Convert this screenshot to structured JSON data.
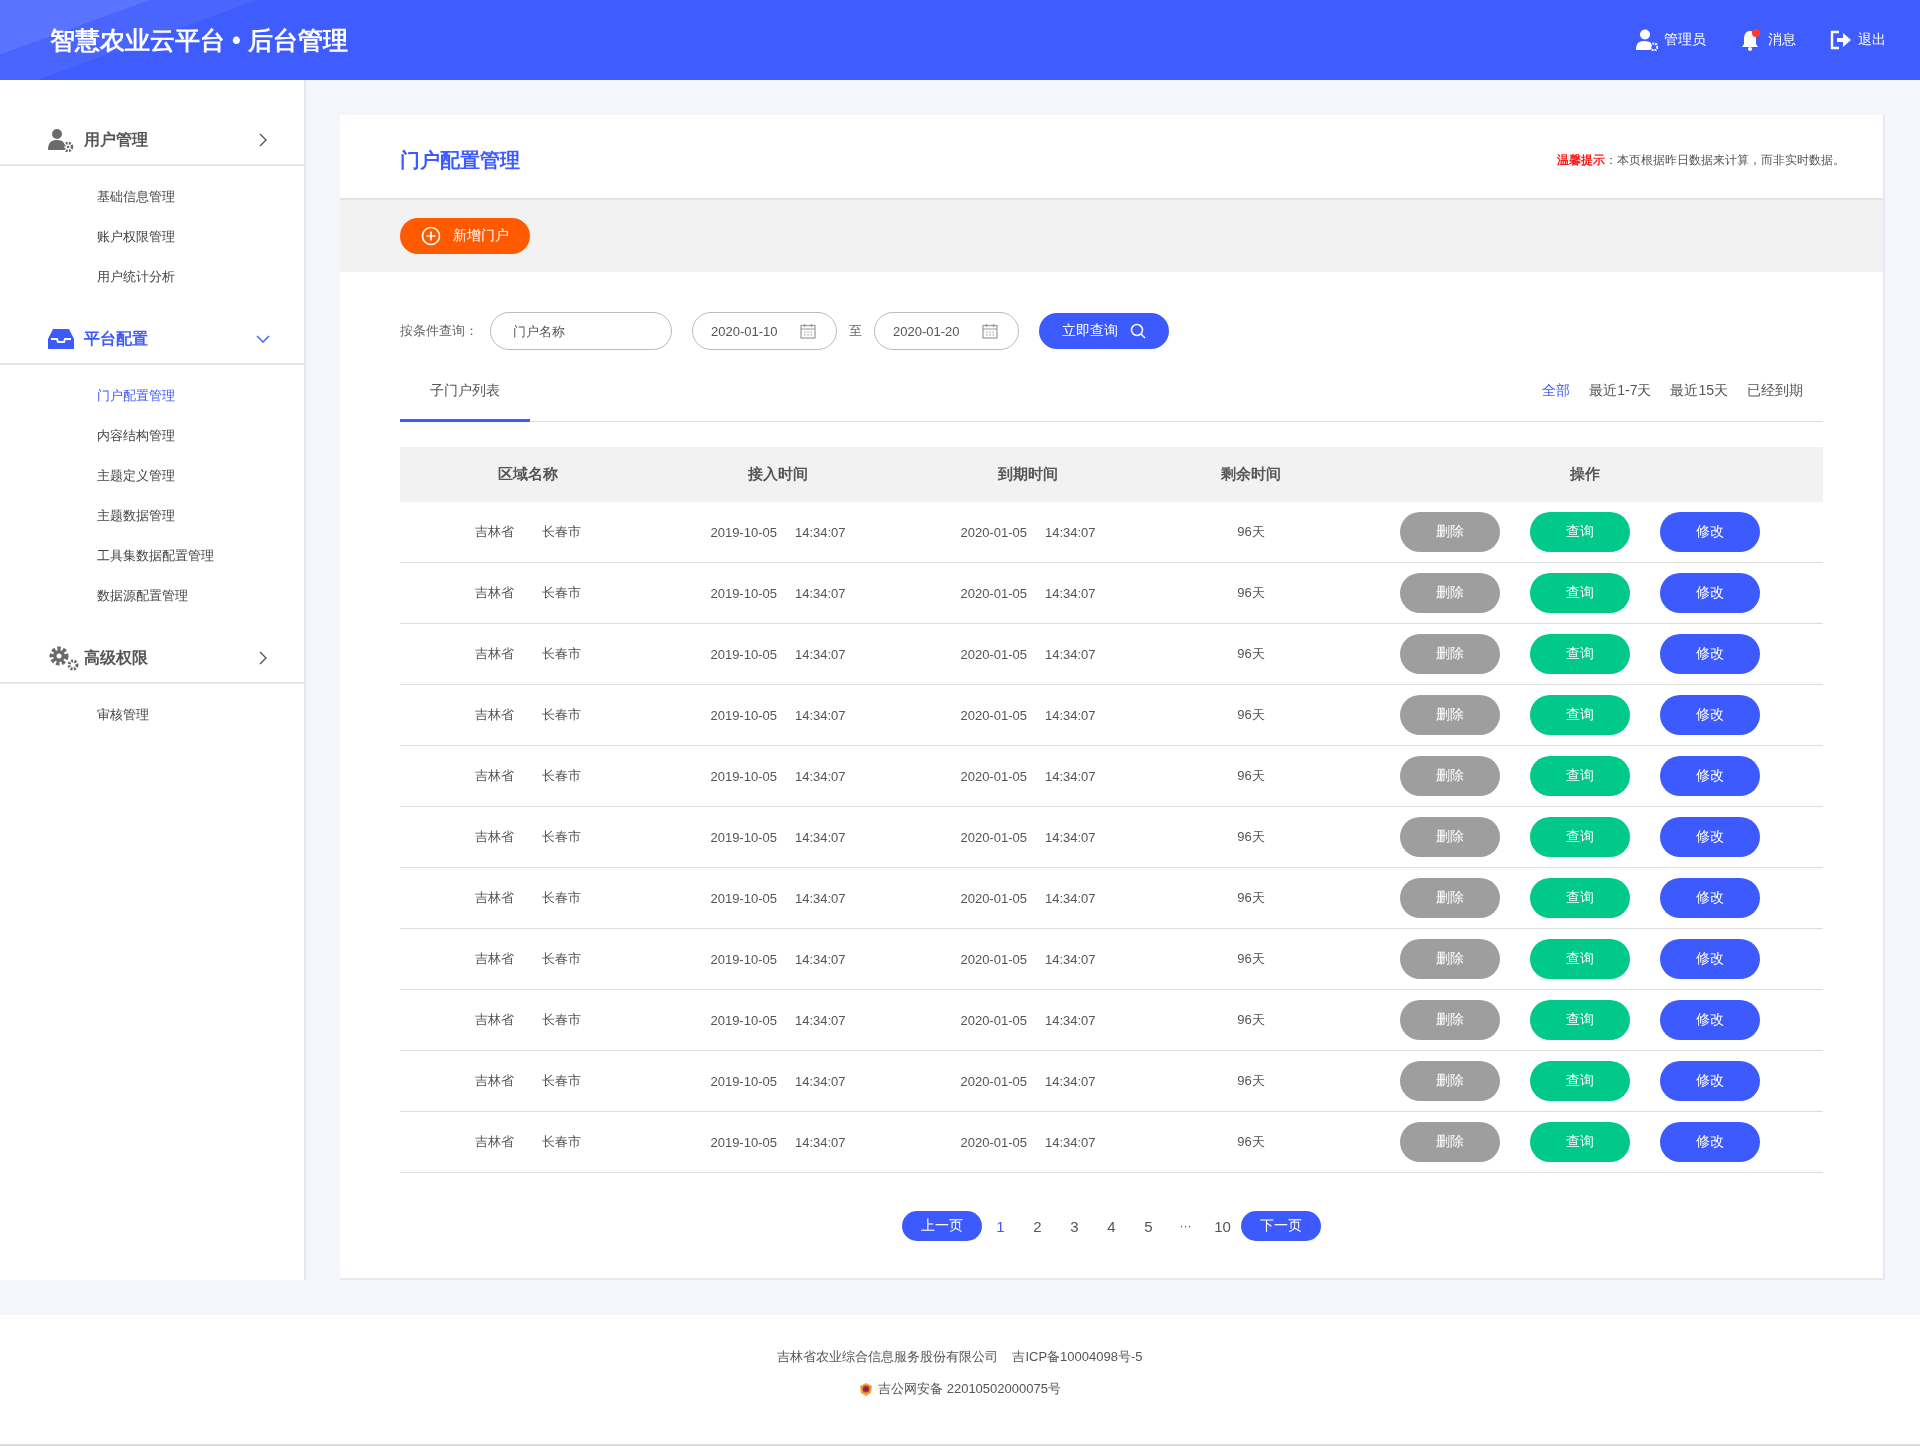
{
  "header": {
    "title": "智慧农业云平台 • 后台管理",
    "actions": [
      {
        "kind": "user",
        "label": "管理员"
      },
      {
        "kind": "bell",
        "label": "消息",
        "badge": true
      },
      {
        "kind": "logout",
        "label": "退出"
      }
    ]
  },
  "sidebar": {
    "groups": [
      {
        "kind": "user",
        "label": "用户管理",
        "selected": false,
        "expanded": false,
        "items": [
          {
            "label": "基础信息管理",
            "selected": false
          },
          {
            "label": "账户权限管理",
            "selected": false
          },
          {
            "label": "用户统计分析",
            "selected": false
          }
        ]
      },
      {
        "kind": "inbox",
        "label": "平台配置",
        "selected": true,
        "expanded": true,
        "items": [
          {
            "label": "门户配置管理",
            "selected": true
          },
          {
            "label": "内容结构管理",
            "selected": false
          },
          {
            "label": "主题定义管理",
            "selected": false
          },
          {
            "label": "主题数据管理",
            "selected": false
          },
          {
            "label": "工具集数据配置管理",
            "selected": false
          },
          {
            "label": "数据源配置管理",
            "selected": false
          }
        ]
      },
      {
        "kind": "gear",
        "label": "高级权限",
        "selected": false,
        "expanded": false,
        "items": [
          {
            "label": "审核管理",
            "selected": false
          }
        ]
      }
    ]
  },
  "page": {
    "title": "门户配置管理",
    "notice": "**温馨提示**：本页根据昨日数据来计算，而非实时数据。",
    "add_button": "新增门户"
  },
  "filter": {
    "label": "按条件查询：",
    "name_field": {
      "placeholder": "门户名称"
    },
    "date_from": "2020-01-10",
    "separator": "至",
    "date_to": "2020-01-20",
    "search_button": "立即查询"
  },
  "tabs": [
    {
      "label": "子门户列表",
      "selected": true
    }
  ],
  "ranges": [
    {
      "label": "全部",
      "selected": true
    },
    {
      "label": "最近1-7天",
      "selected": false
    },
    {
      "label": "最近15天",
      "selected": false
    },
    {
      "label": "已经到期",
      "selected": false
    }
  ],
  "table": {
    "columns": [
      "区域名称",
      "接入时间",
      "到期时间",
      "剩余时间",
      "操作"
    ],
    "rows": [
      {
        "province": "吉林省",
        "city": "长春市",
        "join_date": "2019-10-05",
        "join_time": "14:34:07",
        "expire_date": "2020-01-05",
        "expire_time": "14:34:07",
        "remaining": "96天",
        "actions": [
          {
            "kind": "delete",
            "label": "删除"
          },
          {
            "kind": "view",
            "label": "查询"
          },
          {
            "kind": "edit",
            "label": "修改"
          }
        ]
      },
      {
        "province": "吉林省",
        "city": "长春市",
        "join_date": "2019-10-05",
        "join_time": "14:34:07",
        "expire_date": "2020-01-05",
        "expire_time": "14:34:07",
        "remaining": "96天",
        "actions": [
          {
            "kind": "delete",
            "label": "删除"
          },
          {
            "kind": "view",
            "label": "查询"
          },
          {
            "kind": "edit",
            "label": "修改"
          }
        ]
      },
      {
        "province": "吉林省",
        "city": "长春市",
        "join_date": "2019-10-05",
        "join_time": "14:34:07",
        "expire_date": "2020-01-05",
        "expire_time": "14:34:07",
        "remaining": "96天",
        "actions": [
          {
            "kind": "delete",
            "label": "删除"
          },
          {
            "kind": "view",
            "label": "查询"
          },
          {
            "kind": "edit",
            "label": "修改"
          }
        ]
      },
      {
        "province": "吉林省",
        "city": "长春市",
        "join_date": "2019-10-05",
        "join_time": "14:34:07",
        "expire_date": "2020-01-05",
        "expire_time": "14:34:07",
        "remaining": "96天",
        "actions": [
          {
            "kind": "delete",
            "label": "删除"
          },
          {
            "kind": "view",
            "label": "查询"
          },
          {
            "kind": "edit",
            "label": "修改"
          }
        ]
      },
      {
        "province": "吉林省",
        "city": "长春市",
        "join_date": "2019-10-05",
        "join_time": "14:34:07",
        "expire_date": "2020-01-05",
        "expire_time": "14:34:07",
        "remaining": "96天",
        "actions": [
          {
            "kind": "delete",
            "label": "删除"
          },
          {
            "kind": "view",
            "label": "查询"
          },
          {
            "kind": "edit",
            "label": "修改"
          }
        ]
      },
      {
        "province": "吉林省",
        "city": "长春市",
        "join_date": "2019-10-05",
        "join_time": "14:34:07",
        "expire_date": "2020-01-05",
        "expire_time": "14:34:07",
        "remaining": "96天",
        "actions": [
          {
            "kind": "delete",
            "label": "删除"
          },
          {
            "kind": "view",
            "label": "查询"
          },
          {
            "kind": "edit",
            "label": "修改"
          }
        ]
      },
      {
        "province": "吉林省",
        "city": "长春市",
        "join_date": "2019-10-05",
        "join_time": "14:34:07",
        "expire_date": "2020-01-05",
        "expire_time": "14:34:07",
        "remaining": "96天",
        "actions": [
          {
            "kind": "delete",
            "label": "删除"
          },
          {
            "kind": "view",
            "label": "查询"
          },
          {
            "kind": "edit",
            "label": "修改"
          }
        ]
      },
      {
        "province": "吉林省",
        "city": "长春市",
        "join_date": "2019-10-05",
        "join_time": "14:34:07",
        "expire_date": "2020-01-05",
        "expire_time": "14:34:07",
        "remaining": "96天",
        "actions": [
          {
            "kind": "delete",
            "label": "删除"
          },
          {
            "kind": "view",
            "label": "查询"
          },
          {
            "kind": "edit",
            "label": "修改"
          }
        ]
      },
      {
        "province": "吉林省",
        "city": "长春市",
        "join_date": "2019-10-05",
        "join_time": "14:34:07",
        "expire_date": "2020-01-05",
        "expire_time": "14:34:07",
        "remaining": "96天",
        "actions": [
          {
            "kind": "delete",
            "label": "删除"
          },
          {
            "kind": "view",
            "label": "查询"
          },
          {
            "kind": "edit",
            "label": "修改"
          }
        ]
      },
      {
        "province": "吉林省",
        "city": "长春市",
        "join_date": "2019-10-05",
        "join_time": "14:34:07",
        "expire_date": "2020-01-05",
        "expire_time": "14:34:07",
        "remaining": "96天",
        "actions": [
          {
            "kind": "delete",
            "label": "删除"
          },
          {
            "kind": "view",
            "label": "查询"
          },
          {
            "kind": "edit",
            "label": "修改"
          }
        ]
      },
      {
        "province": "吉林省",
        "city": "长春市",
        "join_date": "2019-10-05",
        "join_time": "14:34:07",
        "expire_date": "2020-01-05",
        "expire_time": "14:34:07",
        "remaining": "96天",
        "actions": [
          {
            "kind": "delete",
            "label": "删除"
          },
          {
            "kind": "view",
            "label": "查询"
          },
          {
            "kind": "edit",
            "label": "修改"
          }
        ]
      }
    ]
  },
  "pagination": {
    "prev": "上一页",
    "pages": [
      {
        "kind": "page",
        "label": "1",
        "selected": true
      },
      {
        "kind": "page",
        "label": "2",
        "selected": false
      },
      {
        "kind": "page",
        "label": "3",
        "selected": false
      },
      {
        "kind": "page",
        "label": "4",
        "selected": false
      },
      {
        "kind": "page",
        "label": "5",
        "selected": false
      },
      {
        "kind": "gap",
        "label": "···"
      },
      {
        "kind": "page",
        "label": "10",
        "selected": false
      }
    ],
    "next": "下一页"
  },
  "footer": {
    "company": "吉林省农业综合信息服务股份有限公司",
    "icp": "吉ICP备10004098号-5",
    "police": "吉公网安备 22010502000075号"
  }
}
